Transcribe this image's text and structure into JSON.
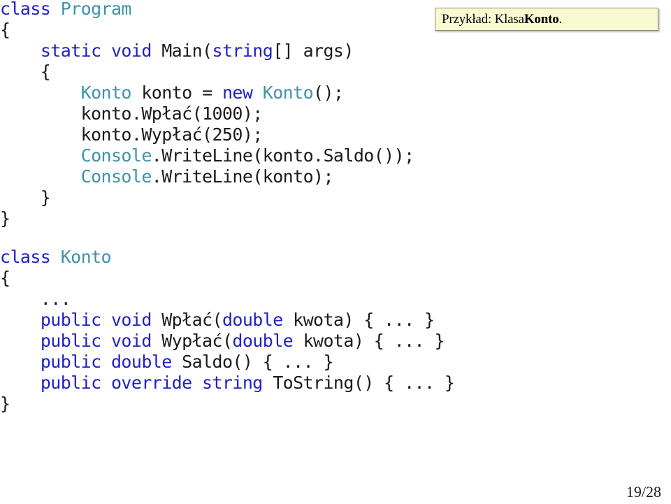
{
  "slide": {
    "background_color": "#ffffff",
    "page_number": "19/28"
  },
  "callout": {
    "name": "przyklad-callout",
    "prefix": "Przykład: Klasa ",
    "emphasis": "Konto",
    "suffix": ".",
    "full_text": "Przykład: Klasa Konto.",
    "background_color": "#f9f9d2",
    "border_color": "#8a8a70"
  },
  "syntax_colors": {
    "keyword": "#2020c8",
    "type": "#3f93a6",
    "plain": "#1a1a1a"
  },
  "code_blocks": [
    {
      "name": "program-class-listing",
      "lines": [
        [
          {
            "t": "class ",
            "c": "kw"
          },
          {
            "t": "Program",
            "c": "typ"
          }
        ],
        [
          {
            "t": "{",
            "c": "pln"
          }
        ],
        [
          {
            "t": "    ",
            "c": "pln"
          },
          {
            "t": "static void ",
            "c": "kw"
          },
          {
            "t": "Main(",
            "c": "pln"
          },
          {
            "t": "string",
            "c": "kw"
          },
          {
            "t": "[] args)",
            "c": "pln"
          }
        ],
        [
          {
            "t": "    {",
            "c": "pln"
          }
        ],
        [
          {
            "t": "        ",
            "c": "pln"
          },
          {
            "t": "Konto",
            "c": "typ"
          },
          {
            "t": " konto = ",
            "c": "pln"
          },
          {
            "t": "new ",
            "c": "kw"
          },
          {
            "t": "Konto",
            "c": "typ"
          },
          {
            "t": "();",
            "c": "pln"
          }
        ],
        [
          {
            "t": "        konto.Wpłać(1000);",
            "c": "pln"
          }
        ],
        [
          {
            "t": "        konto.Wypłać(250);",
            "c": "pln"
          }
        ],
        [
          {
            "t": "        ",
            "c": "pln"
          },
          {
            "t": "Console",
            "c": "typ"
          },
          {
            "t": ".WriteLine(konto.Saldo());",
            "c": "pln"
          }
        ],
        [
          {
            "t": "        ",
            "c": "pln"
          },
          {
            "t": "Console",
            "c": "typ"
          },
          {
            "t": ".WriteLine(konto);",
            "c": "pln"
          }
        ],
        [
          {
            "t": "    }",
            "c": "pln"
          }
        ],
        [
          {
            "t": "}",
            "c": "pln"
          }
        ]
      ]
    },
    {
      "name": "konto-class-listing",
      "lines": [
        [
          {
            "t": "class ",
            "c": "kw"
          },
          {
            "t": "Konto",
            "c": "typ"
          }
        ],
        [
          {
            "t": "{",
            "c": "pln"
          }
        ],
        [
          {
            "t": "    ...",
            "c": "pln"
          }
        ],
        [
          {
            "t": "    ",
            "c": "pln"
          },
          {
            "t": "public void ",
            "c": "kw"
          },
          {
            "t": "Wpłać(",
            "c": "pln"
          },
          {
            "t": "double",
            "c": "kw"
          },
          {
            "t": " kwota) { ... }",
            "c": "pln"
          }
        ],
        [
          {
            "t": "    ",
            "c": "pln"
          },
          {
            "t": "public void ",
            "c": "kw"
          },
          {
            "t": "Wypłać(",
            "c": "pln"
          },
          {
            "t": "double",
            "c": "kw"
          },
          {
            "t": " kwota) { ... }",
            "c": "pln"
          }
        ],
        [
          {
            "t": "    ",
            "c": "pln"
          },
          {
            "t": "public double ",
            "c": "kw"
          },
          {
            "t": "Saldo() { ... }",
            "c": "pln"
          }
        ],
        [
          {
            "t": "    ",
            "c": "pln"
          },
          {
            "t": "public override string ",
            "c": "kw"
          },
          {
            "t": "ToString() { ... }",
            "c": "pln"
          }
        ],
        [
          {
            "t": "}",
            "c": "pln"
          }
        ]
      ]
    }
  ]
}
